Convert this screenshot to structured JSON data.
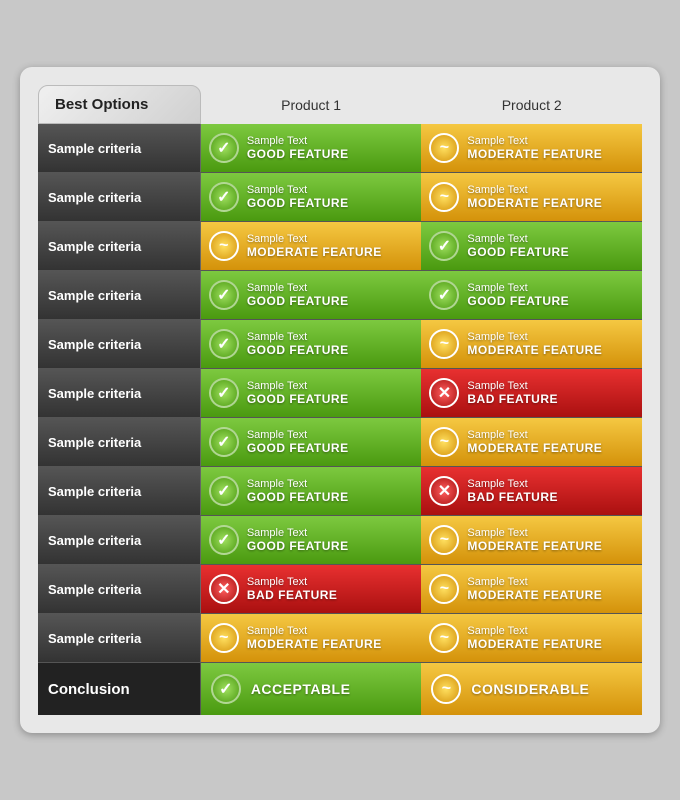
{
  "header": {
    "options_label": "Best Options",
    "product1_label": "Product 1",
    "product2_label": "Product 2"
  },
  "rows": [
    {
      "criteria": "Sample criteria",
      "p1": {
        "type": "good",
        "line1": "Sample Text",
        "line2": "GOOD FEATURE"
      },
      "p2": {
        "type": "moderate",
        "line1": "Sample Text",
        "line2": "MODERATE FEATURE"
      }
    },
    {
      "criteria": "Sample criteria",
      "p1": {
        "type": "good",
        "line1": "Sample Text",
        "line2": "GOOD FEATURE"
      },
      "p2": {
        "type": "moderate",
        "line1": "Sample Text",
        "line2": "MODERATE FEATURE"
      }
    },
    {
      "criteria": "Sample criteria",
      "p1": {
        "type": "moderate",
        "line1": "Sample Text",
        "line2": "MODERATE FEATURE"
      },
      "p2": {
        "type": "good",
        "line1": "Sample Text",
        "line2": "GOOD FEATURE"
      }
    },
    {
      "criteria": "Sample criteria",
      "p1": {
        "type": "good",
        "line1": "Sample Text",
        "line2": "GOOD FEATURE"
      },
      "p2": {
        "type": "good",
        "line1": "Sample Text",
        "line2": "GOOD FEATURE"
      }
    },
    {
      "criteria": "Sample criteria",
      "p1": {
        "type": "good",
        "line1": "Sample Text",
        "line2": "GOOD FEATURE"
      },
      "p2": {
        "type": "moderate",
        "line1": "Sample Text",
        "line2": "MODERATE FEATURE"
      }
    },
    {
      "criteria": "Sample criteria",
      "p1": {
        "type": "good",
        "line1": "Sample Text",
        "line2": "GOOD FEATURE"
      },
      "p2": {
        "type": "bad",
        "line1": "Sample Text",
        "line2": "BAD FEATURE"
      }
    },
    {
      "criteria": "Sample criteria",
      "p1": {
        "type": "good",
        "line1": "Sample Text",
        "line2": "GOOD FEATURE"
      },
      "p2": {
        "type": "moderate",
        "line1": "Sample Text",
        "line2": "MODERATE FEATURE"
      }
    },
    {
      "criteria": "Sample criteria",
      "p1": {
        "type": "good",
        "line1": "Sample Text",
        "line2": "GOOD FEATURE"
      },
      "p2": {
        "type": "bad",
        "line1": "Sample Text",
        "line2": "BAD FEATURE"
      }
    },
    {
      "criteria": "Sample criteria",
      "p1": {
        "type": "good",
        "line1": "Sample Text",
        "line2": "GOOD FEATURE"
      },
      "p2": {
        "type": "moderate",
        "line1": "Sample Text",
        "line2": "MODERATE FEATURE"
      }
    },
    {
      "criteria": "Sample criteria",
      "p1": {
        "type": "bad",
        "line1": "Sample Text",
        "line2": "BAD FEATURE"
      },
      "p2": {
        "type": "moderate",
        "line1": "Sample Text",
        "line2": "MODERATE FEATURE"
      }
    },
    {
      "criteria": "Sample criteria",
      "p1": {
        "type": "moderate",
        "line1": "Sample Text",
        "line2": "MODERATE FEATURE"
      },
      "p2": {
        "type": "moderate",
        "line1": "Sample Text",
        "line2": "MODERATE FEATURE"
      }
    }
  ],
  "conclusion": {
    "label": "Conclusion",
    "p1": {
      "type": "good",
      "text": "ACCEPTABLE"
    },
    "p2": {
      "type": "moderate",
      "text": "CONSIDERABLE"
    }
  },
  "icons": {
    "good": "✓",
    "moderate": "~",
    "bad": "✕"
  }
}
